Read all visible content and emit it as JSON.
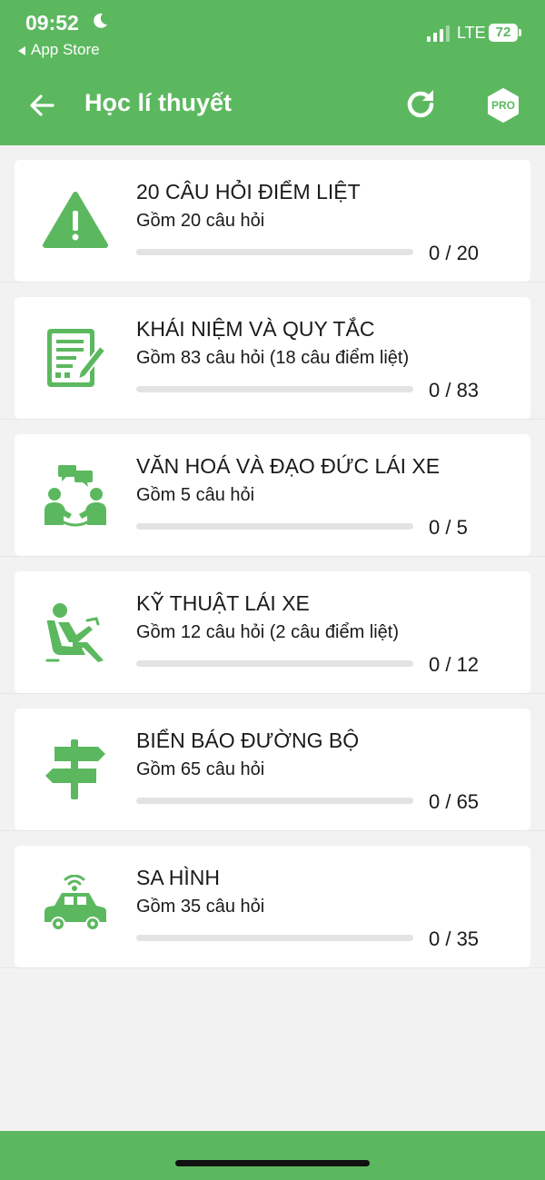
{
  "status": {
    "time": "09:52",
    "back_app": "App Store",
    "network": "LTE",
    "battery": "72"
  },
  "header": {
    "title": "Học lí thuyết",
    "pro_label": "PRO"
  },
  "colors": {
    "accent": "#5cb85f",
    "background": "#f2f2f2"
  },
  "categories": [
    {
      "icon": "warning-icon",
      "title": "20 CÂU HỎI ĐIỂM LIỆT",
      "subtitle": "Gồm 20 câu hỏi",
      "progress": 0,
      "count": "0 / 20"
    },
    {
      "icon": "document-pen-icon",
      "title": "KHÁI NIỆM VÀ QUY TẮC",
      "subtitle": "Gồm 83 câu hỏi (18 câu điểm liệt)",
      "progress": 0,
      "count": "0 / 83"
    },
    {
      "icon": "people-chat-icon",
      "title": "VĂN HOÁ VÀ ĐẠO ĐỨC LÁI XE",
      "subtitle": "Gồm 5 câu hỏi",
      "progress": 0,
      "count": "0 / 5"
    },
    {
      "icon": "driver-seat-icon",
      "title": "KỸ THUẬT LÁI XE",
      "subtitle": "Gồm 12 câu hỏi (2 câu điểm liệt)",
      "progress": 0,
      "count": "0 / 12"
    },
    {
      "icon": "signpost-icon",
      "title": "BIỂN BÁO ĐƯỜNG BỘ",
      "subtitle": "Gồm 65 câu hỏi",
      "progress": 0,
      "count": "0 / 65"
    },
    {
      "icon": "car-icon",
      "title": "SA HÌNH",
      "subtitle": "Gồm 35 câu hỏi",
      "progress": 0,
      "count": "0 / 35"
    }
  ]
}
